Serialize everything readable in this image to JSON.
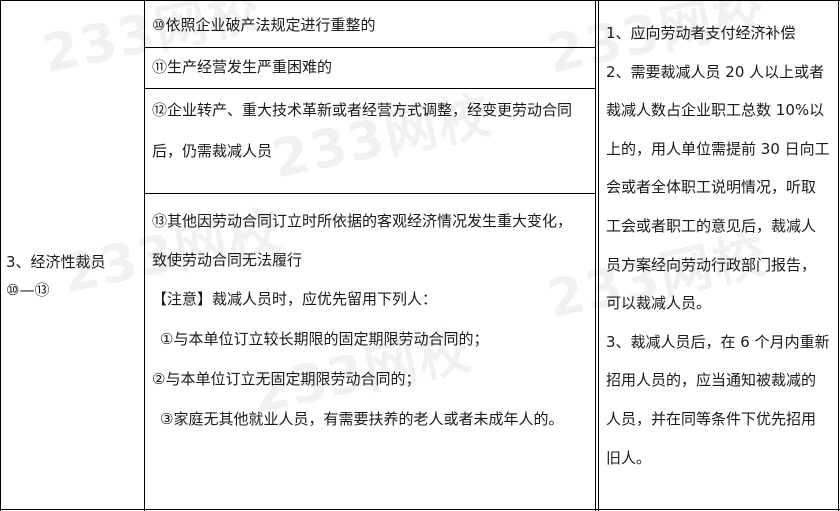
{
  "left_cell": {
    "label_line1": "3、经济性裁员",
    "label_line2": "⑩—⑬"
  },
  "middle_cells": {
    "cell1": "⑩依照企业破产法规定进行重整的",
    "cell2": "⑪生产经营发生严重困难的",
    "cell3_line1": "⑫企业转产、重大技术革新或者经营方式调整，经变更劳动合同",
    "cell3_line2": "后，仍需裁减人员",
    "cell4_line1": "⑬其他因劳动合同订立时所依据的客观经济情况发生重大变化，",
    "cell4_line2": "致使劳动合同无法履行",
    "note_header": "【注意】裁减人员时，应优先留用下列人：",
    "note_item1": "①与本单位订立较长期限的固定期限劳动合同的；",
    "note_item2": "②与本单位订立无固定期限劳动合同的；",
    "note_item3": "③家庭无其他就业人员，有需要扶养的老人或者未成年人的。"
  },
  "right_cell": {
    "lines": [
      "1、应向劳动者支付经济补偿",
      "2、需要裁减人员 20 人以上或者",
      "裁减人数占企业职工总数 10%以",
      "上的，用人单位需提前 30 日向工",
      "会或者全体职工说明情况，听取",
      "工会或者职工的意见后，裁减人",
      "员方案经向劳动行政部门报告，",
      "可以裁减人员。",
      "3、裁减人员后，在 6 个月内重新",
      "招用人员的，应当通知被裁减的",
      "人员，并在同等条件下优先招用",
      "旧人。"
    ]
  },
  "watermark": {
    "text": "233网校"
  }
}
